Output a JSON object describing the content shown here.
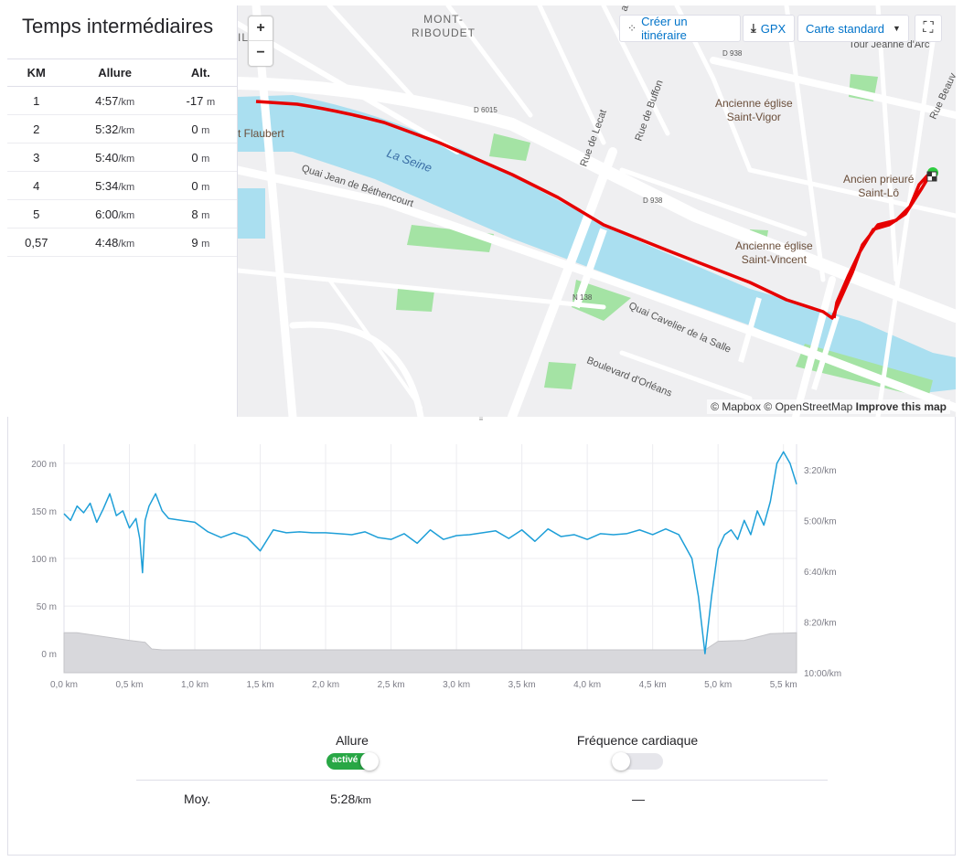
{
  "splits": {
    "title": "Temps intermédiaires",
    "headers": [
      "KM",
      "Allure",
      "Alt."
    ],
    "rows": [
      {
        "km": "1",
        "pace": "4:57",
        "pace_unit": "/km",
        "alt": "-17",
        "alt_unit": "m"
      },
      {
        "km": "2",
        "pace": "5:32",
        "pace_unit": "/km",
        "alt": "0",
        "alt_unit": "m"
      },
      {
        "km": "3",
        "pace": "5:40",
        "pace_unit": "/km",
        "alt": "0",
        "alt_unit": "m"
      },
      {
        "km": "4",
        "pace": "5:34",
        "pace_unit": "/km",
        "alt": "0",
        "alt_unit": "m"
      },
      {
        "km": "5",
        "pace": "6:00",
        "pace_unit": "/km",
        "alt": "8",
        "alt_unit": "m"
      },
      {
        "km": "0,57",
        "pace": "4:48",
        "pace_unit": "/km",
        "alt": "9",
        "alt_unit": "m"
      }
    ]
  },
  "map": {
    "zoom_in": "+",
    "zoom_out": "−",
    "create_route": "Créer un itinéraire",
    "gpx": "GPX",
    "map_style": "Carte standard",
    "attribution_mapbox": "© Mapbox",
    "attribution_osm": "© OpenStreetMap",
    "improve": "Improve this map",
    "labels": {
      "mont_riboudet": "MONT-\nRIBOUDET",
      "tour_jeanne": "Tour Jeanne d'Arc",
      "saint_vigor": "Ancienne église\nSaint-Vigor",
      "prieure": "Ancien prieuré\nSaint-Lô",
      "saint_vincent": "Ancienne église\nSaint-Vincent",
      "flaubert": "t Flaubert",
      "seine": "La Seine",
      "quai_bethencourt": "Quai Jean de Béthencourt",
      "quai_cavelier": "Quai Cavelier de la Salle",
      "bd_orleans": "Boulevard d'Orléans",
      "rue_lecat": "Rue de Lecat",
      "rue_buffon": "Rue de Buffon",
      "rue_beauv": "Rue Beauv",
      "d6015": "D 6015",
      "d938a": "D 938",
      "d938b": "D 938",
      "n138": "N 138",
      "il": "IL",
      "ard": "ard"
    },
    "colors": {
      "water": "#aadff0",
      "park": "#a4e3a4",
      "route": "#e60000",
      "road": "#ffffff"
    }
  },
  "chart_data": {
    "type": "area",
    "x_unit": "km",
    "xlim": [
      0,
      5.6
    ],
    "x_ticks": [
      "0,0 km",
      "0,5 km",
      "1,0 km",
      "1,5 km",
      "2,0 km",
      "2,5 km",
      "3,0 km",
      "3,5 km",
      "4,0 km",
      "4,5 km",
      "5,0 km",
      "5,5 km"
    ],
    "left_axis": {
      "label": "",
      "ticks": [
        "0 m",
        "50 m",
        "100 m",
        "150 m",
        "200 m"
      ],
      "ylim": [
        -20,
        220
      ]
    },
    "right_axis": {
      "label": "",
      "ticks": [
        "3:20/km",
        "5:00/km",
        "6:40/km",
        "8:20/km",
        "10:00/km"
      ]
    },
    "series": [
      {
        "kind": "elevation",
        "color": "#d8d8dc",
        "x": [
          0,
          0.1,
          0.5,
          0.62,
          0.67,
          0.75,
          1.0,
          2.0,
          3.0,
          4.0,
          4.9,
          5.0,
          5.2,
          5.4,
          5.6
        ],
        "y": [
          22,
          22,
          14,
          12,
          5,
          4,
          4,
          4,
          4,
          4,
          4,
          13,
          14,
          21,
          22
        ]
      },
      {
        "kind": "pace",
        "color": "#1e9fd8",
        "x": [
          0,
          0.05,
          0.1,
          0.15,
          0.2,
          0.25,
          0.3,
          0.35,
          0.4,
          0.45,
          0.5,
          0.55,
          0.58,
          0.6,
          0.62,
          0.65,
          0.7,
          0.75,
          0.8,
          0.9,
          1.0,
          1.1,
          1.2,
          1.3,
          1.4,
          1.5,
          1.6,
          1.7,
          1.8,
          1.9,
          2.0,
          2.1,
          2.2,
          2.3,
          2.4,
          2.5,
          2.6,
          2.7,
          2.8,
          2.9,
          3.0,
          3.1,
          3.2,
          3.3,
          3.4,
          3.5,
          3.6,
          3.7,
          3.8,
          3.9,
          4.0,
          4.1,
          4.2,
          4.3,
          4.4,
          4.5,
          4.6,
          4.7,
          4.8,
          4.85,
          4.9,
          4.95,
          5.0,
          5.05,
          5.1,
          5.15,
          5.2,
          5.25,
          5.3,
          5.35,
          5.4,
          5.45,
          5.5,
          5.55,
          5.6
        ],
        "y": [
          147,
          140,
          155,
          148,
          158,
          138,
          152,
          168,
          145,
          150,
          132,
          142,
          120,
          85,
          140,
          155,
          168,
          150,
          142,
          140,
          138,
          128,
          122,
          127,
          122,
          108,
          130,
          127,
          128,
          127,
          127,
          126,
          125,
          128,
          122,
          120,
          126,
          116,
          130,
          120,
          124,
          125,
          127,
          129,
          121,
          130,
          118,
          131,
          123,
          125,
          120,
          126,
          125,
          126,
          130,
          125,
          131,
          125,
          100,
          60,
          0,
          60,
          110,
          125,
          130,
          120,
          140,
          125,
          150,
          135,
          160,
          200,
          212,
          200,
          178
        ]
      }
    ]
  },
  "toggles": {
    "pace_label": "Allure",
    "pace_state": "activé",
    "hr_label": "Fréquence cardiaque"
  },
  "averages": {
    "label": "Moy.",
    "pace": "5:28",
    "pace_unit": "/km",
    "hr": "—"
  }
}
